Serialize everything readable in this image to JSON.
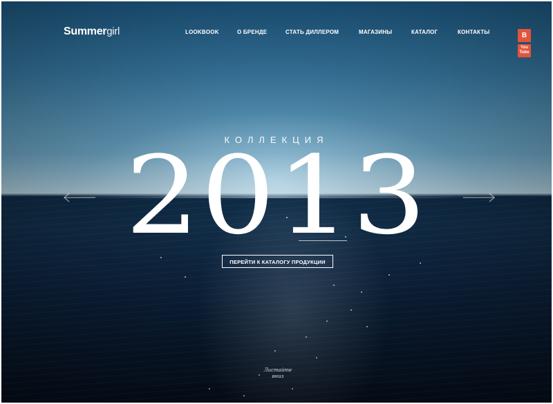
{
  "brand": {
    "logo_bold": "Summer",
    "logo_light": "girl"
  },
  "nav": {
    "items": [
      {
        "label": "LOOKBOOK"
      },
      {
        "label": "О БРЕНДЕ"
      },
      {
        "label": "СТАТЬ ДИЛЛЕРОМ"
      },
      {
        "label": "МАГАЗИНЫ"
      },
      {
        "label": "КАТАЛОГ"
      },
      {
        "label": "КОНТАКТЫ"
      }
    ]
  },
  "social": {
    "vk_label": "B",
    "youtube_label_top": "You",
    "youtube_label_bottom": "Tube"
  },
  "hero": {
    "kicker": "КОЛЛЕКЦИЯ",
    "year": "2013",
    "cta_label": "ПЕРЕЙТИ К КАТАЛОГУ ПРОДУКЦИИ",
    "scroll_hint_line1": "Листайте",
    "scroll_hint_line2": "вниз"
  },
  "icons": {
    "prev": "arrow-left-icon",
    "next": "arrow-right-icon"
  },
  "colors": {
    "accent_social": "#e2553c",
    "text": "#ffffff",
    "sky_top": "#1f5f8c",
    "sea_dark": "#060f1d"
  }
}
